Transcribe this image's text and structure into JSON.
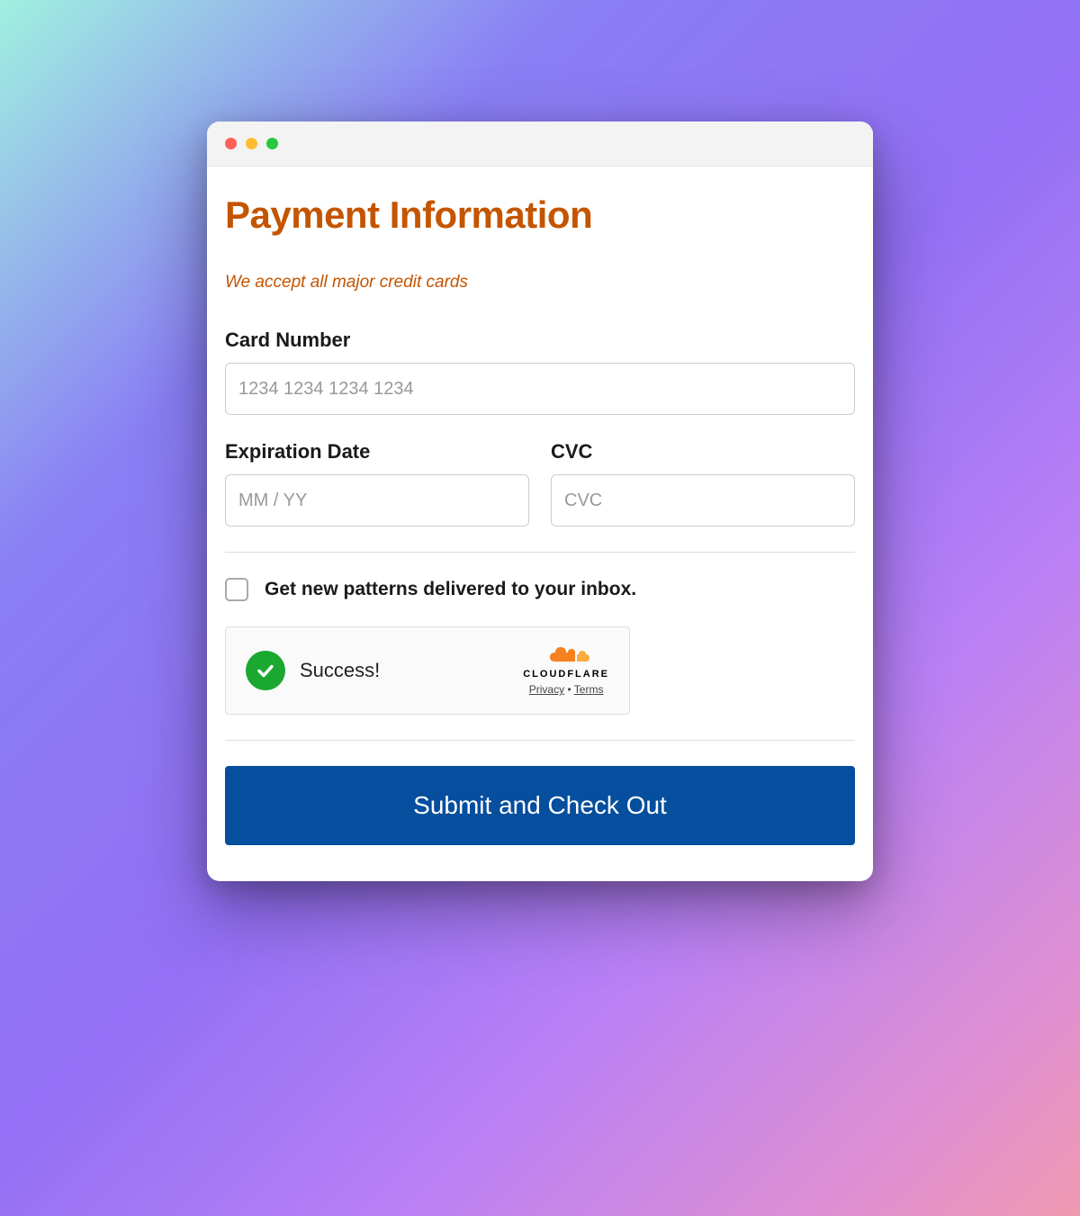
{
  "header": {
    "title": "Payment Information",
    "subtitle": "We accept all major credit cards"
  },
  "fields": {
    "card_number": {
      "label": "Card Number",
      "placeholder": "1234 1234 1234 1234",
      "value": ""
    },
    "expiration": {
      "label": "Expiration Date",
      "placeholder": "MM / YY",
      "value": ""
    },
    "cvc": {
      "label": "CVC",
      "placeholder": "CVC",
      "value": ""
    }
  },
  "newsletter": {
    "label": "Get new patterns delivered to your inbox.",
    "checked": false
  },
  "captcha": {
    "status": "Success!",
    "brand": "CLOUDFLARE",
    "privacy_label": "Privacy",
    "terms_label": "Terms",
    "separator": "•"
  },
  "submit": {
    "label": "Submit and Check Out"
  }
}
